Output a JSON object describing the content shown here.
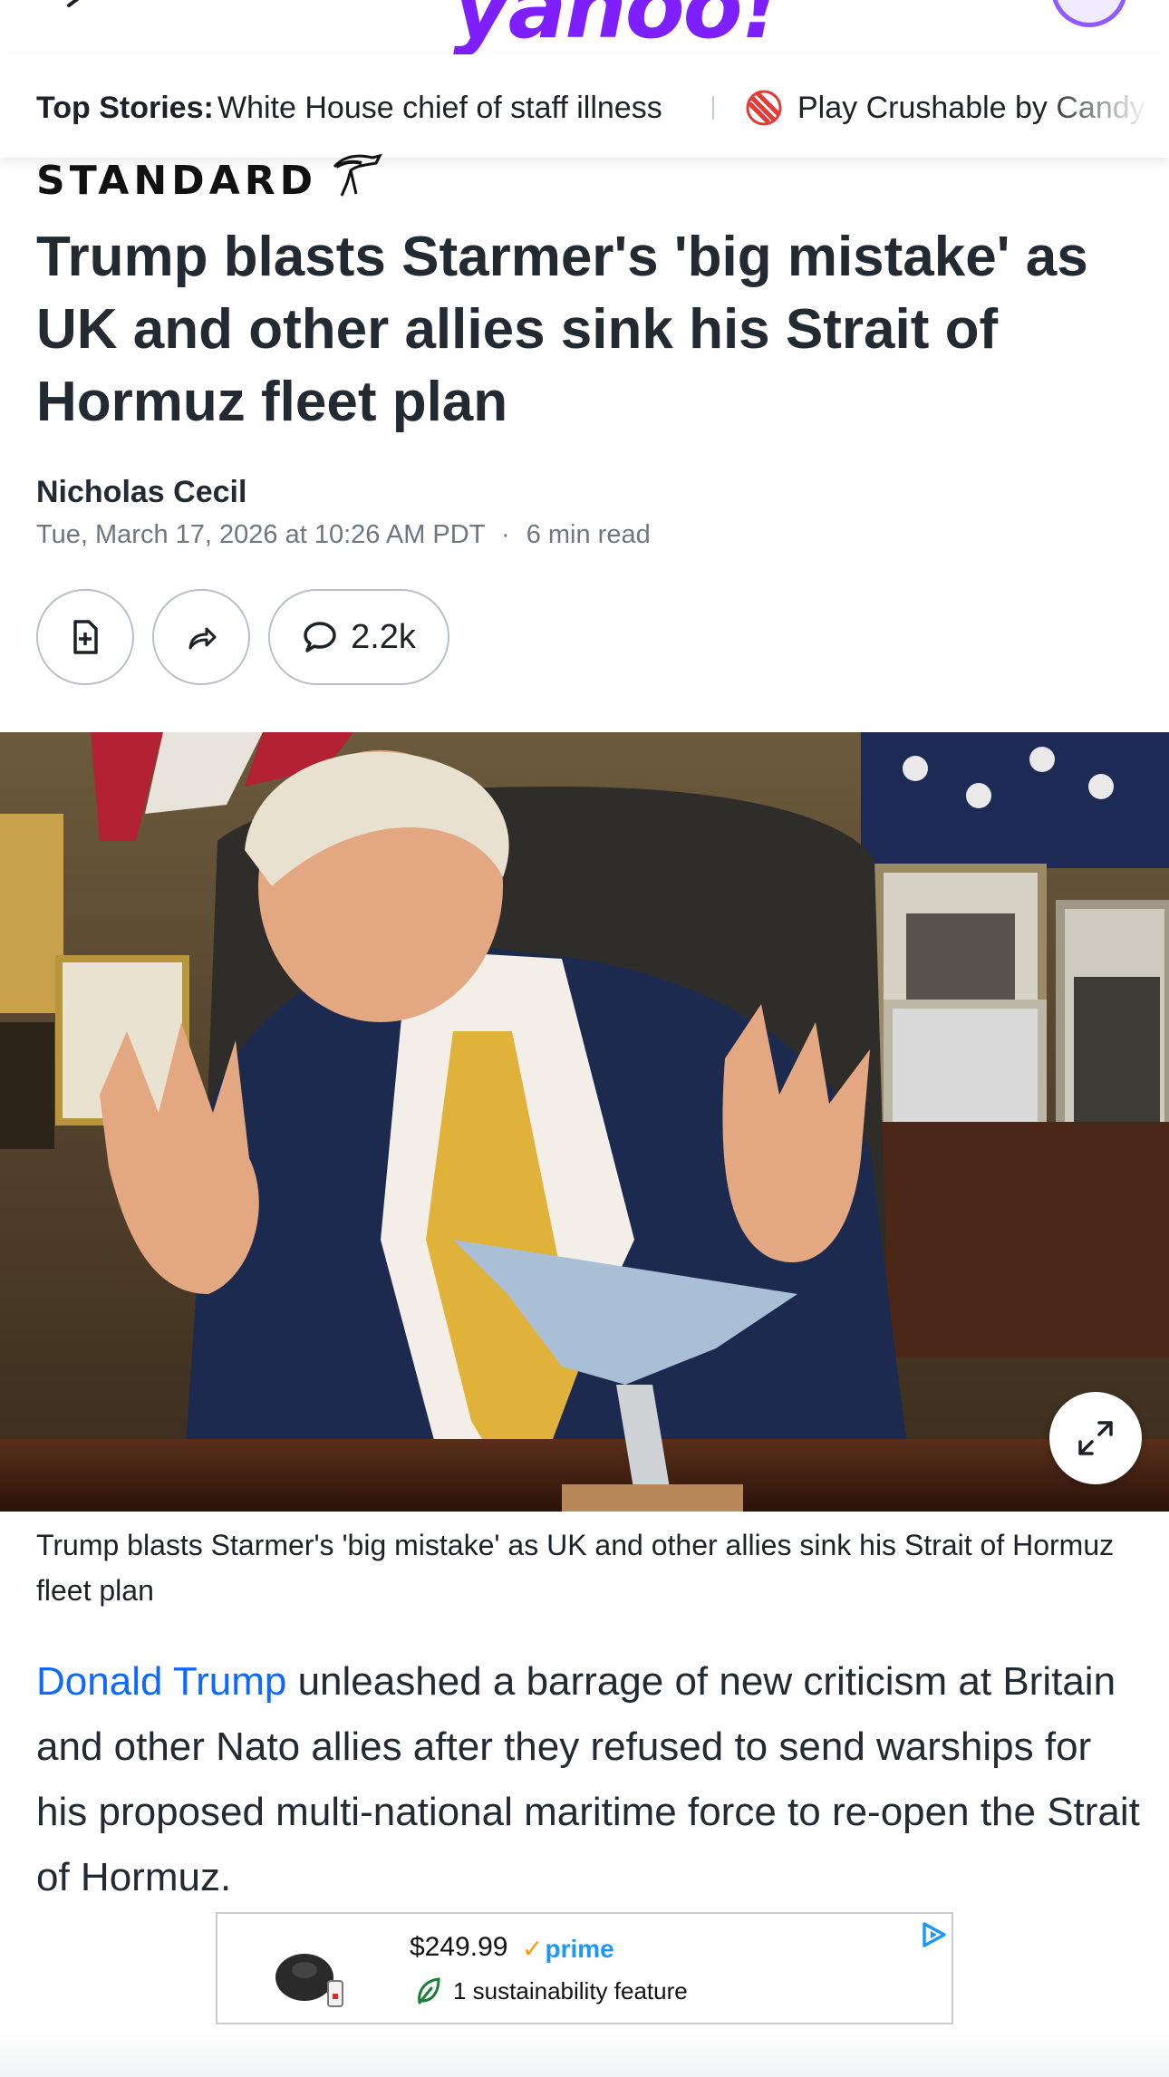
{
  "header": {
    "logo_text": "yahoo!"
  },
  "ticker": {
    "label": "Top Stories:",
    "items": [
      "White House chief of staff illness",
      "Play Crushable by Candy"
    ]
  },
  "article": {
    "publisher": "STANDARD",
    "headline": "Trump blasts Starmer's 'big mistake' as UK and other allies sink his Strait of Hormuz fleet plan",
    "author": "Nicholas Cecil",
    "date": "Tue, March 17, 2026 at 10:26 AM PDT",
    "separator": "·",
    "read_time": "6 min read",
    "comment_count": "2.2k",
    "caption": "Trump blasts Starmer's 'big mistake' as UK and other allies sink his Strait of Hormuz fleet plan",
    "body_link": "Donald Trump",
    "body_rest": " unleashed a barrage of new criticism at Britain and other Nato allies after they refused to send warships for his proposed multi-national maritime force to re-open the Strait of Hormuz."
  },
  "ad": {
    "price": "$249.99",
    "prime": "prime",
    "feature": "1 sustainability feature"
  },
  "icons": {
    "back": "back-arrow-icon",
    "save": "save-document-icon",
    "share": "share-icon",
    "comment": "comment-bubble-icon",
    "expand": "expand-icon",
    "adchoices": "adchoices-icon",
    "leaf": "leaf-icon"
  },
  "colors": {
    "brand": "#7e1fff",
    "link": "#0f69ff",
    "prime": "#1a98ff"
  }
}
